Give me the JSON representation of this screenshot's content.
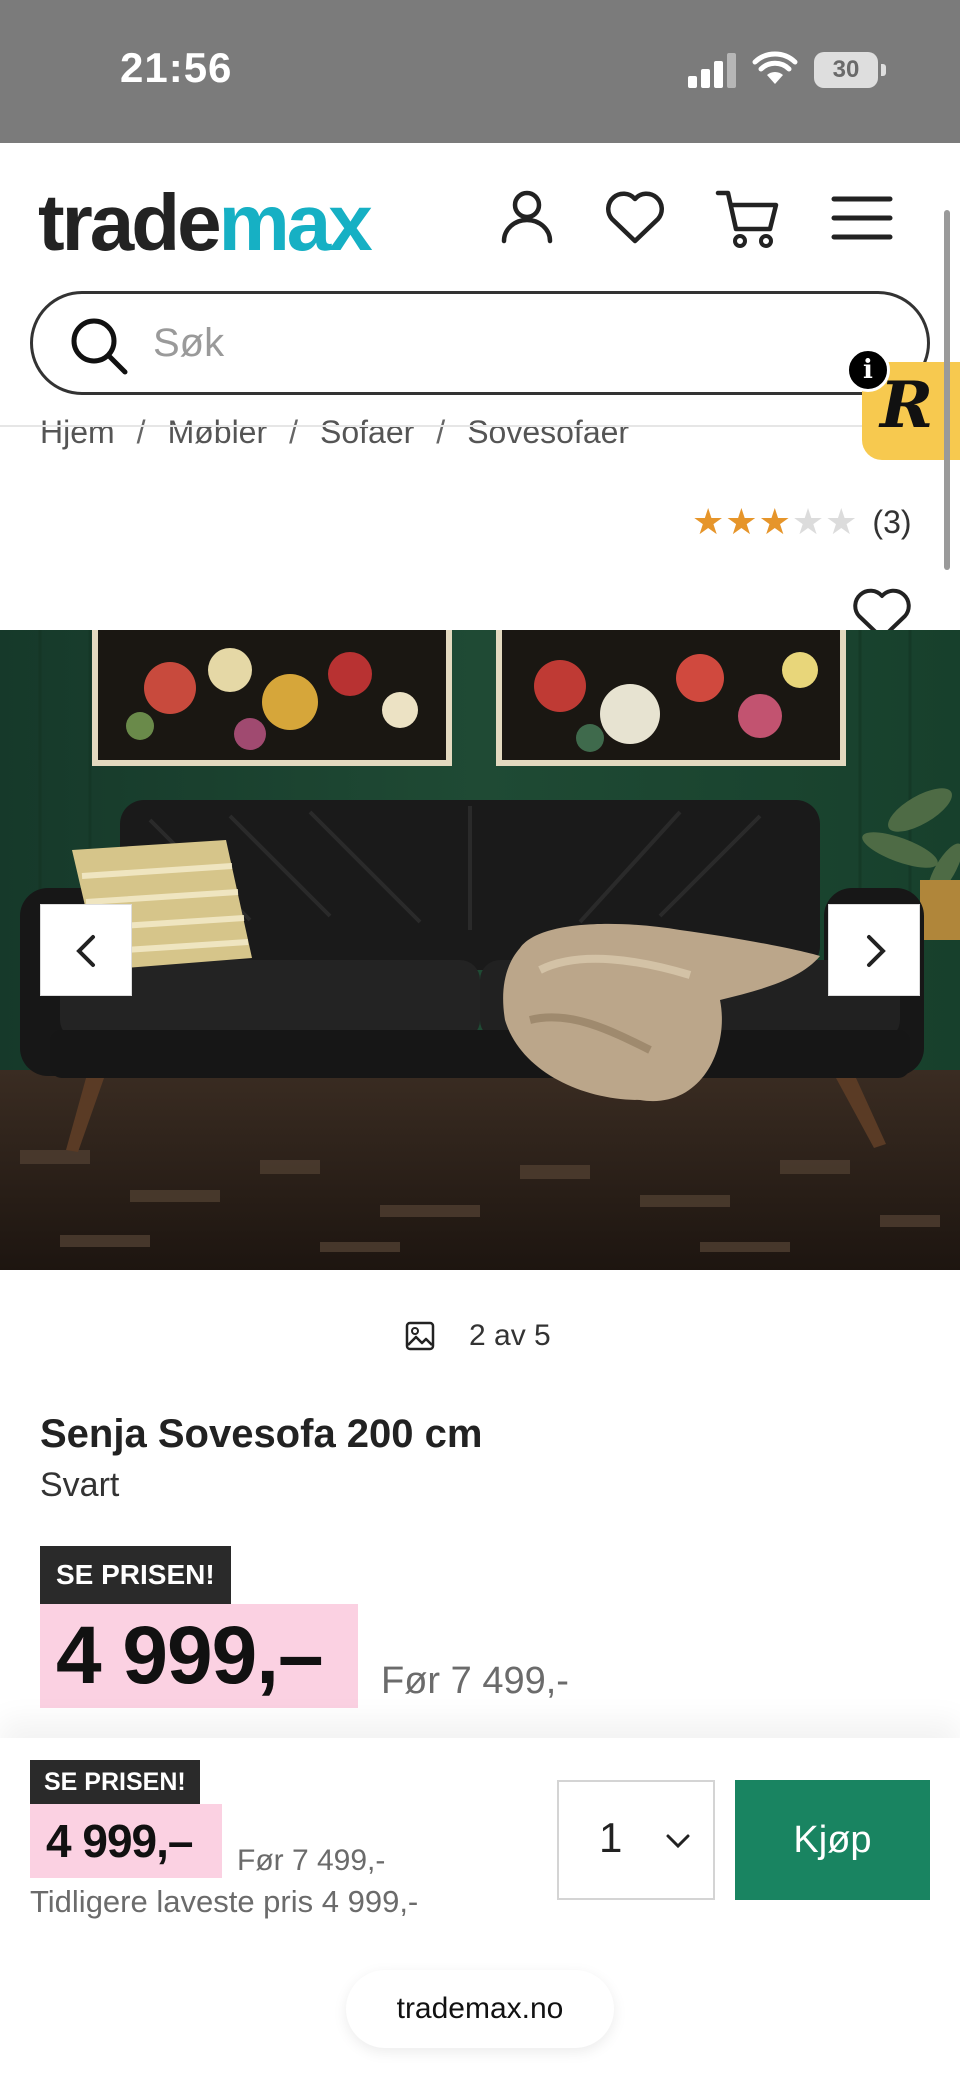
{
  "status_bar": {
    "time": "21:56",
    "battery": "30"
  },
  "header": {
    "logo": {
      "part1": "trade",
      "part2": "max"
    },
    "search": {
      "placeholder": "Søk"
    }
  },
  "breadcrumb": [
    "Hjem",
    "Møbler",
    "Sofaer",
    "Sovesofaer"
  ],
  "rating": {
    "stars_filled": 3,
    "stars_total": 5,
    "count_label": "(3)"
  },
  "gallery": {
    "counter": "2 av 5"
  },
  "product": {
    "title": "Senja Sovesofa 200 cm",
    "color": "Svart",
    "tag": "SE PRISEN!",
    "price": "4 999,–",
    "previous_price": "Før 7 499,-"
  },
  "buy_bar": {
    "tag": "SE PRISEN!",
    "price": "4 999,–",
    "previous_price": "Før 7 499,-",
    "lowest_price": "Tidligere laveste pris 4 999,-",
    "quantity": "1",
    "buy_label": "Kjøp"
  },
  "browser": {
    "url": "trademax.no"
  },
  "colors": {
    "brand_teal": "#16b0c4",
    "buy_green": "#198461",
    "price_pink": "#fbd1e2",
    "star": "#e6952a"
  }
}
